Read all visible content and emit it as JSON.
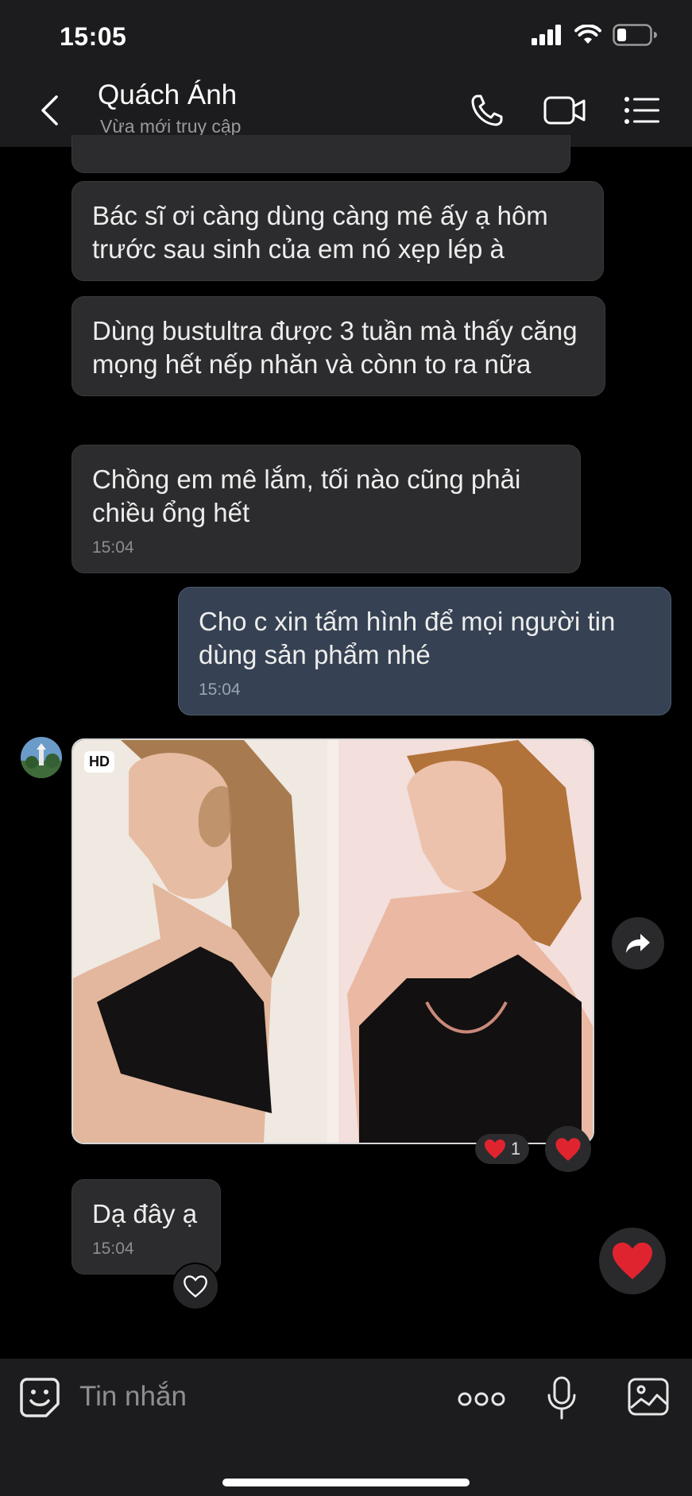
{
  "status_bar": {
    "time": "15:05",
    "icons": [
      "signal-icon",
      "wifi-icon",
      "battery-icon"
    ]
  },
  "header": {
    "contact_name": "Quách Ánh",
    "contact_status": "Vừa mới truy cập",
    "icons": [
      "back-icon",
      "phone-icon",
      "video-call-icon",
      "menu-list-icon"
    ]
  },
  "messages": [
    {
      "sender": "contact",
      "text": "Bác sĩ ơi càng dùng càng mê ấy ạ hôm trước sau sinh của em nó xẹp lép à"
    },
    {
      "sender": "contact",
      "text": "Dùng bustultra được 3 tuần mà thấy căng mọng hết nếp nhăn và cònn to ra nữa"
    },
    {
      "sender": "contact",
      "text": "Chồng em mê lắm, tối nào cũng phải chiều ổng hết",
      "time": "15:04"
    },
    {
      "sender": "me",
      "text": "Cho c xin tấm hình để mọi người tin dùng sản phẩm nhé",
      "time": "15:04"
    },
    {
      "sender": "contact",
      "type": "photo",
      "badge": "HD",
      "reaction_count": "1"
    },
    {
      "sender": "contact",
      "text": "Dạ đây ạ",
      "time": "15:04"
    }
  ],
  "input_bar": {
    "placeholder": "Tin nhắn",
    "icons": [
      "sticker-icon",
      "more-icon",
      "microphone-icon",
      "gallery-icon"
    ]
  },
  "colors": {
    "background": "#000000",
    "bar_background": "#1c1c1e",
    "incoming_bubble": "#2c2c2e",
    "outgoing_bubble": "#364253",
    "heart": "#e0242f"
  }
}
